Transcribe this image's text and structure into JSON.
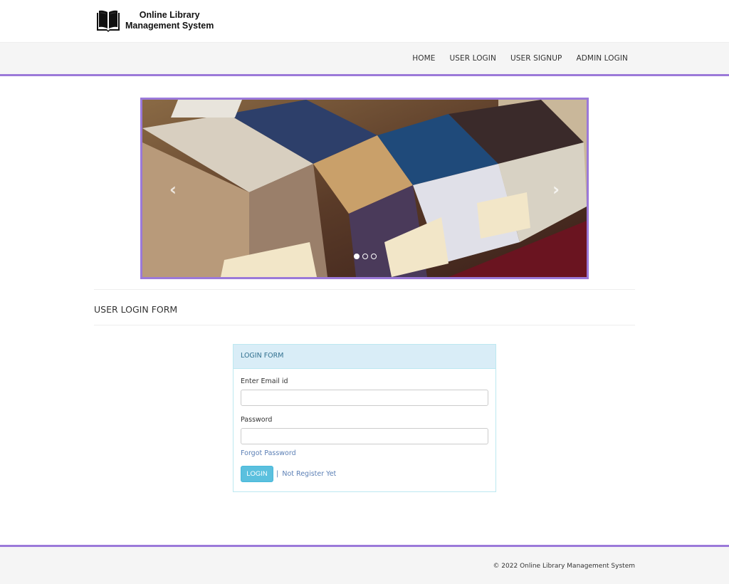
{
  "brand": {
    "line1": "Online Library",
    "line2": "Management System",
    "icon": "book-icon"
  },
  "nav": {
    "items": [
      {
        "label": "HOME"
      },
      {
        "label": "USER LOGIN"
      },
      {
        "label": "USER SIGNUP"
      },
      {
        "label": "ADMIN LOGIN"
      }
    ]
  },
  "carousel": {
    "prev_glyph": "‹",
    "next_glyph": "›",
    "slide_count": 3,
    "active_slide": 1
  },
  "section": {
    "title": "USER LOGIN FORM"
  },
  "login_form": {
    "heading": "LOGIN FORM",
    "email_label": "Enter Email id",
    "email_value": "",
    "password_label": "Password",
    "password_value": "",
    "forgot_label": "Forgot Password",
    "login_label": "LOGIN",
    "separator": "|",
    "register_label": "Not Register Yet"
  },
  "footer": {
    "text": "© 2022 Online Library Management System"
  },
  "colors": {
    "accent": "#9b79d9",
    "panel_heading_bg": "#d9edf7",
    "button_bg": "#5bc0de",
    "link": "#5b7fb5"
  }
}
